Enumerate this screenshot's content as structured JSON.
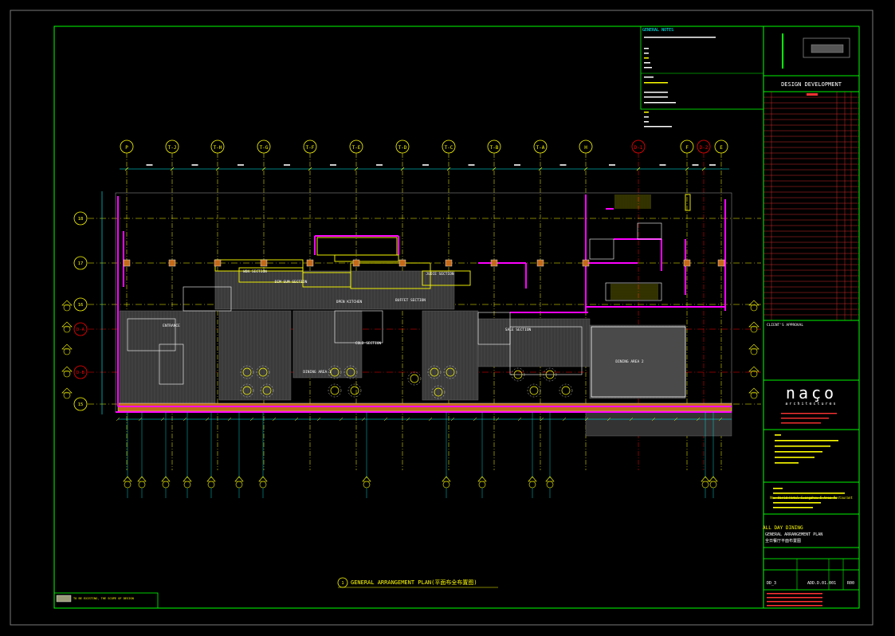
{
  "drawing": {
    "title": "GENERAL ARRANGEMENT PLAN(平面布全布置图)",
    "title_number": "1",
    "grid_columns_top": [
      "P",
      "T-J",
      "T-H",
      "T-G",
      "T-F",
      "T-E",
      "T-D",
      "T-C",
      "T-B",
      "T-A",
      "H",
      "D-1",
      "F",
      "D-2",
      "E"
    ],
    "grid_rows_left": [
      "18",
      "17",
      "16",
      "D-A",
      "D-B",
      "15"
    ],
    "room_labels": [
      "OPEN KITCHEN",
      "DINING AREA 1",
      "DINING AREA 2",
      "ENTRANCE",
      "COLD SECTION",
      "BUFFET SECTION",
      "JUICE SECTION",
      "WOK SECTION",
      "DIM SUM SECTION",
      "SALE SECTION"
    ],
    "legend_text": "TO BE EXISTING, THE SCOPE OF DESIGN"
  },
  "title_block": {
    "general_notes_heading": "GENERAL NOTES",
    "stage": "DESIGN DEVELOPMENT",
    "client_approval": "CLIENT'S APPROVAL",
    "logo": "naço",
    "logo_sub": "architectures",
    "project": "New World Hotel Guangzhou 5 Area Restaurant",
    "drawing_title_l1": "ALL DAY DINING",
    "drawing_title_l2": "GENERAL ARRANGEMENT PLAN",
    "drawing_title_l3": "全日餐厅平面布置图",
    "drawing_no": "ADD.D.01.001",
    "revision": "R00",
    "sheet_label": "DD_3"
  },
  "colors": {
    "frame": "#00ff00",
    "grid_line": "#ffff00",
    "grid_bubble": "#ffff00",
    "red_grid": "#ff0000",
    "wall_magenta": "#ff00ff",
    "dim_cyan": "#00ffff",
    "furniture": "#ffffff"
  }
}
